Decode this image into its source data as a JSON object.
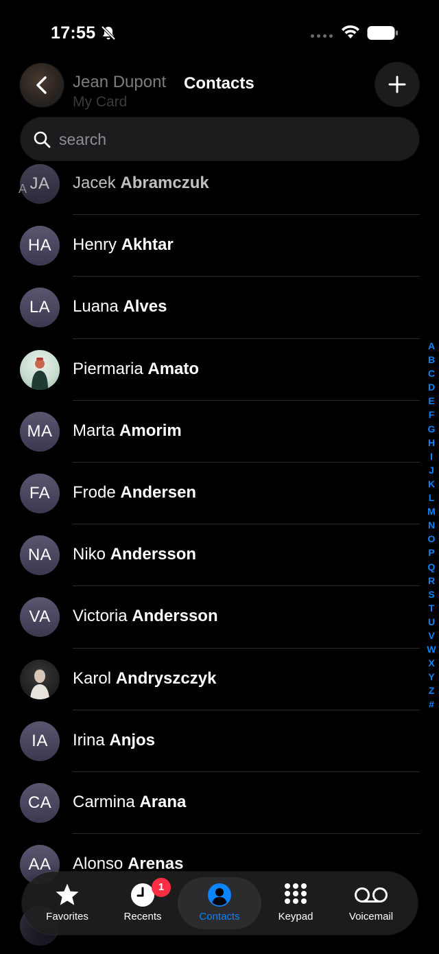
{
  "status": {
    "time": "17:55"
  },
  "header": {
    "my_card_name": "Jean Dupont",
    "my_card_subtitle": "My Card",
    "title": "Contacts"
  },
  "search": {
    "placeholder": "search"
  },
  "section": "A",
  "contacts": [
    {
      "initials": "JA",
      "first": "Jacek",
      "last": "Abramczuk",
      "photo": ""
    },
    {
      "initials": "HA",
      "first": "Henry",
      "last": "Akhtar",
      "photo": ""
    },
    {
      "initials": "LA",
      "first": "Luana",
      "last": "Alves",
      "photo": ""
    },
    {
      "initials": "",
      "first": "Piermaria",
      "last": "Amato",
      "photo": "person-photo"
    },
    {
      "initials": "MA",
      "first": "Marta",
      "last": "Amorim",
      "photo": ""
    },
    {
      "initials": "FA",
      "first": "Frode",
      "last": "Andersen",
      "photo": ""
    },
    {
      "initials": "NA",
      "first": "Niko",
      "last": "Andersson",
      "photo": ""
    },
    {
      "initials": "VA",
      "first": "Victoria",
      "last": "Andersson",
      "photo": ""
    },
    {
      "initials": "",
      "first": "Karol",
      "last": "Andryszczyk",
      "photo": "person-photo"
    },
    {
      "initials": "IA",
      "first": "Irina",
      "last": "Anjos",
      "photo": ""
    },
    {
      "initials": "CA",
      "first": "Carmina",
      "last": "Arana",
      "photo": ""
    },
    {
      "initials": "AA",
      "first": "Alonso",
      "last": "Arenas",
      "photo": ""
    }
  ],
  "index_letters": [
    "A",
    "B",
    "C",
    "D",
    "E",
    "F",
    "G",
    "H",
    "I",
    "J",
    "K",
    "L",
    "M",
    "N",
    "O",
    "P",
    "Q",
    "R",
    "S",
    "T",
    "U",
    "V",
    "W",
    "X",
    "Y",
    "Z",
    "#"
  ],
  "tabs": [
    {
      "label": "Favorites",
      "icon": "star-icon"
    },
    {
      "label": "Recents",
      "icon": "clock-icon",
      "badge": "1"
    },
    {
      "label": "Contacts",
      "icon": "person-circle-icon",
      "active": true
    },
    {
      "label": "Keypad",
      "icon": "keypad-icon"
    },
    {
      "label": "Voicemail",
      "icon": "voicemail-icon"
    }
  ],
  "colors": {
    "accent": "#0a84ff",
    "badge": "#ff2d44",
    "avatar": "#4a4660"
  }
}
